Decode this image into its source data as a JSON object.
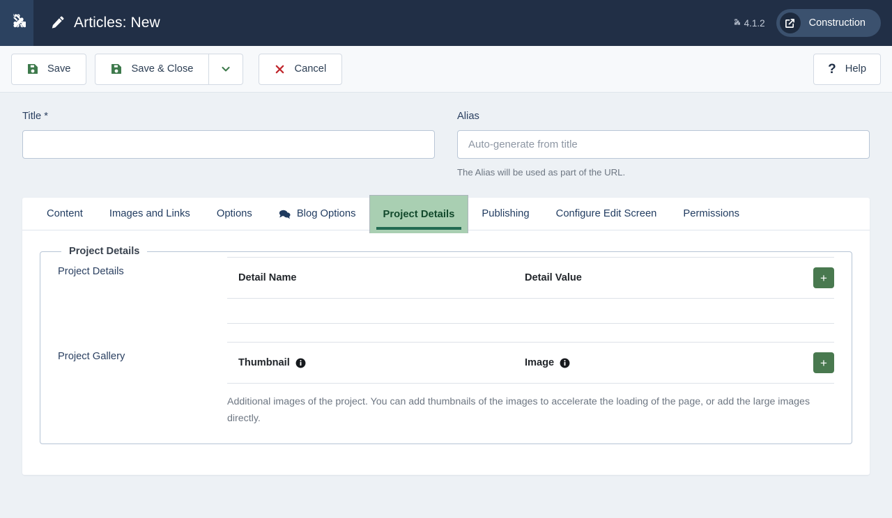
{
  "header": {
    "logo_icon": "joomla-logo-icon",
    "page_icon": "pencil-icon",
    "title": "Articles: New",
    "version_icon": "joomla-mark-icon",
    "version": "4.1.2",
    "preview_icon": "external-link-icon",
    "preview_label": "Construction"
  },
  "toolbar": {
    "save_icon": "save-floppy-icon",
    "save_label": "Save",
    "save_close_icon": "save-floppy-icon",
    "save_close_label": "Save & Close",
    "dropdown_icon": "chevron-down-icon",
    "cancel_icon": "close-x-icon",
    "cancel_label": "Cancel",
    "help_icon": "question-mark-icon",
    "help_label": "Help"
  },
  "form": {
    "title_label": "Title *",
    "title_value": "",
    "title_placeholder": "",
    "alias_label": "Alias",
    "alias_value": "",
    "alias_placeholder": "Auto-generate from title",
    "alias_help": "The Alias will be used as part of the URL."
  },
  "tabs": [
    {
      "label": "Content",
      "icon": null,
      "active": false
    },
    {
      "label": "Images and Links",
      "icon": null,
      "active": false
    },
    {
      "label": "Options",
      "icon": null,
      "active": false
    },
    {
      "label": "Blog Options",
      "icon": "comments-icon",
      "active": false
    },
    {
      "label": "Project Details",
      "icon": null,
      "active": true
    },
    {
      "label": "Publishing",
      "icon": null,
      "active": false
    },
    {
      "label": "Configure Edit Screen",
      "icon": null,
      "active": false
    },
    {
      "label": "Permissions",
      "icon": null,
      "active": false
    }
  ],
  "panel": {
    "fieldset_legend": "Project Details",
    "rows": [
      {
        "label": "Project Details",
        "columns": [
          "Detail Name",
          "Detail Value"
        ],
        "col_icons": [
          null,
          null
        ],
        "add_icon": "plus-icon",
        "add_label": "+",
        "description": ""
      },
      {
        "label": "Project Gallery",
        "columns": [
          "Thumbnail",
          "Image"
        ],
        "col_icons": [
          "info-circle-icon",
          "info-circle-icon"
        ],
        "add_icon": "plus-icon",
        "add_label": "+",
        "description": "Additional images of the project. You can add thumbnails of the images to accelerate the loading of the page, or add the large images directly."
      }
    ]
  },
  "colors": {
    "header_bg": "#212f46",
    "logo_bg": "#2c4260",
    "page_bg": "#edf1f5",
    "accent_green": "#49794f",
    "active_tab_bg": "#a9cfb2",
    "active_tab_text": "#12492c",
    "active_tab_underline": "#226b52",
    "cancel_red": "#c0272d",
    "pill_bg": "#3b516e"
  }
}
